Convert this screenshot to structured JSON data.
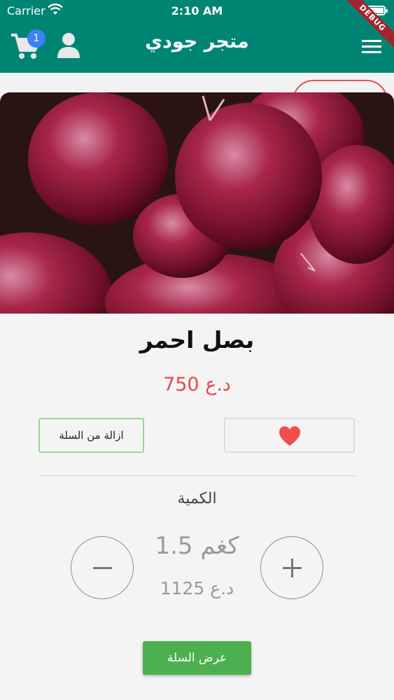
{
  "status_bar": {
    "carrier": "Carrier",
    "time": "2:10 AM"
  },
  "debug_banner": "DEBUG",
  "app_bar": {
    "title": "متجر جودي",
    "cart_count": "1"
  },
  "product": {
    "name": "بصل احمر",
    "price": "750 د.ع",
    "image": "red-onions-photo"
  },
  "actions": {
    "remove_from_cart": "ازالة من السلة",
    "favorite_icon": "heart-icon"
  },
  "quantity": {
    "label": "الكمية",
    "value": "1.5 كغم",
    "total": "1125 د.ع"
  },
  "footer": {
    "view_cart": "عرض السلة"
  },
  "colors": {
    "app_bar": "#008575",
    "price": "#e34b4b",
    "favorite": "#f04e4e",
    "cart_button": "#4caf50",
    "badge": "#3b82f6"
  }
}
